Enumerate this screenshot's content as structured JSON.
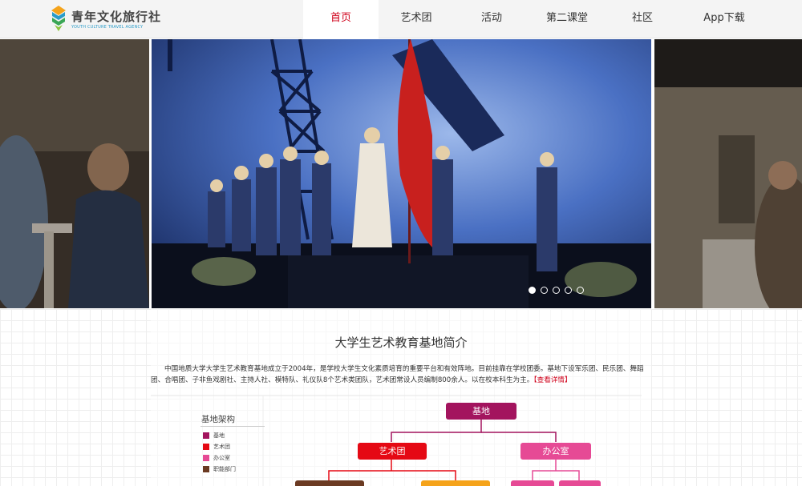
{
  "brand": {
    "title": "青年文化旅行社",
    "subtitle": "YOUTH CULTURE TRAVEL AGENCY"
  },
  "nav": [
    {
      "label": "首页",
      "active": true
    },
    {
      "label": "艺术团",
      "active": false
    },
    {
      "label": "活动",
      "active": false
    },
    {
      "label": "第二课堂",
      "active": false
    },
    {
      "label": "社区",
      "active": false
    },
    {
      "label": "App下载",
      "active": false
    }
  ],
  "carousel": {
    "slide_count": 5,
    "active_index": 0
  },
  "intro": {
    "title": "大学生艺术教育基地简介",
    "text": "中国地质大学大学生艺术教育基地成立于2004年，是学校大学生文化素质培育的重要平台和有效阵地。目前挂靠在学校团委。基地下设军乐团、民乐团、舞蹈团、合唱团、子非鱼戏剧社、主持人社、模特队、礼仪队8个艺术类团队，艺术团常设人员编制800余人。以在校本科生为主。",
    "more_link": "【查看详情】"
  },
  "org_chart": {
    "legend_title": "基地架构",
    "legend": [
      {
        "label": "基地",
        "color": "#a3145e"
      },
      {
        "label": "艺术团",
        "color": "#e50914"
      },
      {
        "label": "办公室",
        "color": "#e64a95"
      },
      {
        "label": "职能部门",
        "color": "#6b3a22"
      }
    ],
    "nodes": {
      "root": "基地",
      "art_troupe": "艺术团",
      "office": "办公室"
    },
    "colors": {
      "root": "#a3145e",
      "art_troupe": "#e50914",
      "office": "#e64a95",
      "dept_brown": "#6b3a22",
      "dept_orange": "#f5a31a",
      "dept_pink": "#e64a95"
    }
  }
}
